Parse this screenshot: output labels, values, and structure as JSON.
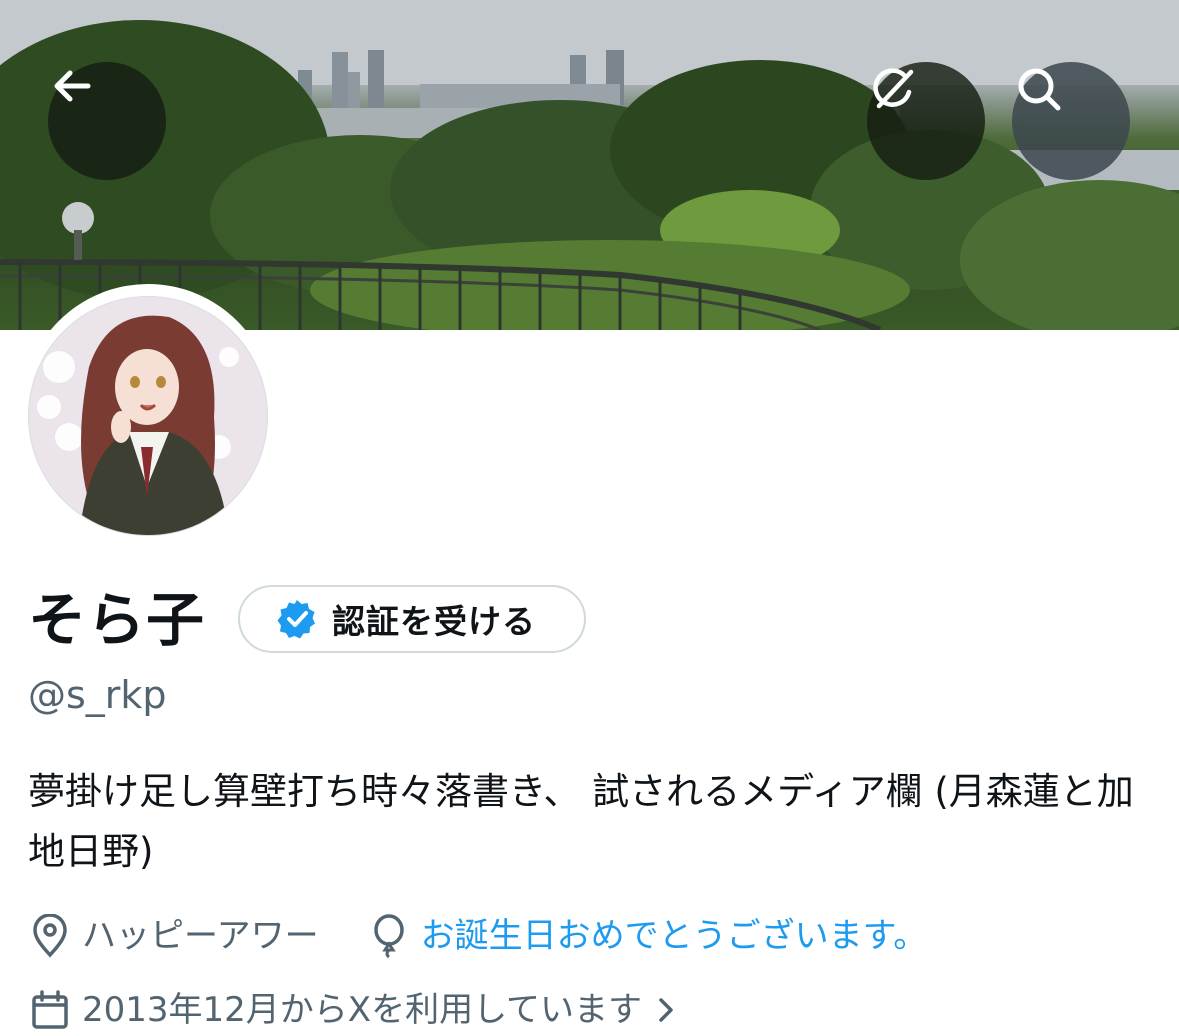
{
  "header": {
    "back_icon": "arrow-left-icon",
    "grok_icon": "grok-icon",
    "search_icon": "search-icon"
  },
  "profile": {
    "display_name": "そら子",
    "verify_button_label": "認証を受ける",
    "handle": "@s_rkp",
    "bio": "夢掛け足し算壁打ち時々落書き、 試されるメディア欄 (月森蓮と加地日野)",
    "location": "ハッピーアワー",
    "birthday": "お誕生日おめでとうございます。",
    "joined": "2013年12月からXを利用しています"
  },
  "colors": {
    "accent": "#1d9bf0",
    "secondary_text": "#536471",
    "primary_text": "#0f1419",
    "pill_border": "#cfd9de"
  }
}
